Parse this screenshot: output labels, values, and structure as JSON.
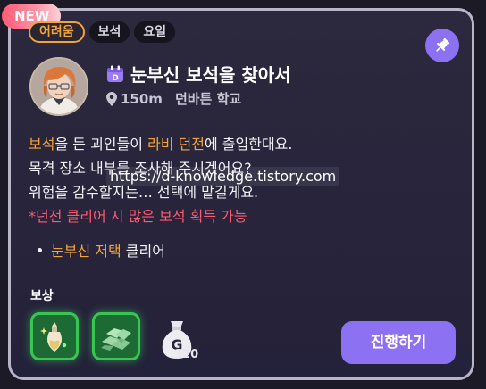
{
  "badge": {
    "label": "NEW"
  },
  "tags": [
    "어려움",
    "보석",
    "요일"
  ],
  "quest": {
    "title": "눈부신 보석을 찾아서",
    "title_icon": "calendar-d-icon",
    "distance": "150m",
    "place": "던바튼 학교",
    "description": {
      "line1": {
        "hl1": "보석",
        "t1": "을 든 괴인들이 ",
        "hl2": "라비 던전",
        "t2": "에 출입한대요."
      },
      "line2": "목격 장소 내부를 조사해 주시겠어요?",
      "line3": "위험을 감수할지는… 선택에 맡길게요.",
      "line4": "*던전 클리어 시 많은 보석 획득 가능"
    },
    "objective": {
      "highlight": "눈부신 저택",
      "rest": " 클리어"
    }
  },
  "watermark": "https://d-knowledge.tistory.com",
  "rewards": {
    "label": "보상",
    "items": [
      {
        "icon": "potion-icon"
      },
      {
        "icon": "gem-pile-icon"
      },
      {
        "icon": "gold-bag-icon",
        "count": "120"
      }
    ]
  },
  "action": {
    "label": "진행하기"
  },
  "colors": {
    "accent": "#8c72f2",
    "highlight": "#f2a43a",
    "warning": "#ff5a6e",
    "reward_border": "#38c653",
    "badge": "#ff5a74"
  }
}
